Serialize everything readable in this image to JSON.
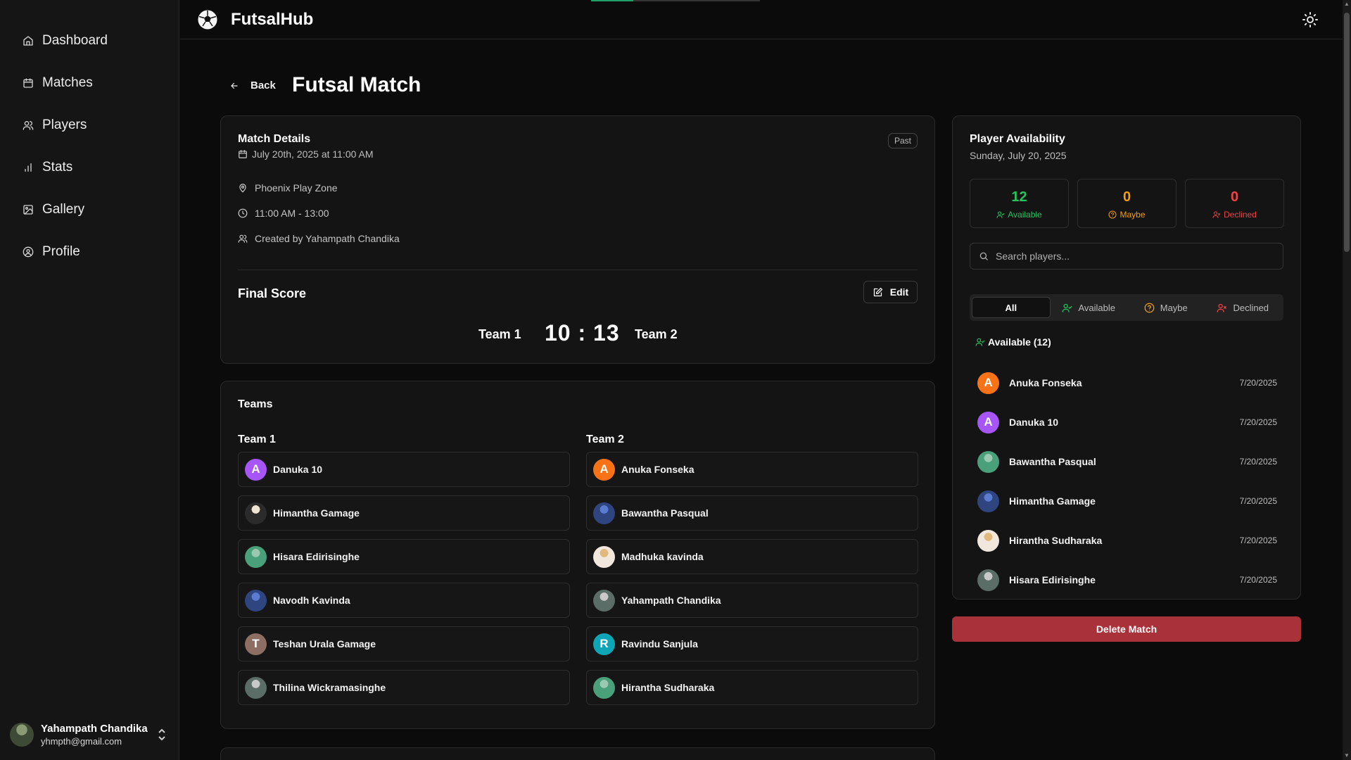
{
  "app": {
    "name": "FutsalHub",
    "loading_progress": 0.25
  },
  "sidebar": {
    "items": [
      {
        "label": "Dashboard",
        "icon": "home-icon"
      },
      {
        "label": "Matches",
        "icon": "calendar-icon"
      },
      {
        "label": "Players",
        "icon": "users-icon"
      },
      {
        "label": "Stats",
        "icon": "bar-chart-icon"
      },
      {
        "label": "Gallery",
        "icon": "image-icon"
      },
      {
        "label": "Profile",
        "icon": "user-circle-icon"
      }
    ],
    "user": {
      "name": "Yahampath Chandika",
      "email": "yhmpth@gmail.com"
    }
  },
  "page": {
    "back_label": "Back",
    "title": "Futsal Match"
  },
  "match_details": {
    "title": "Match Details",
    "date": "July 20th, 2025 at 11:00 AM",
    "status": "Past",
    "location": "Phoenix Play Zone",
    "time": "11:00 AM - 13:00",
    "created_by": "Created by Yahampath Chandika"
  },
  "score": {
    "title": "Final Score",
    "edit_label": "Edit",
    "team1": "Team 1",
    "team2": "Team 2",
    "value": "10 : 13"
  },
  "teams": {
    "title": "Teams",
    "team1": {
      "name": "Team 1",
      "players": [
        {
          "name": "Danuka 10",
          "initial": "A",
          "color": "#a855f7"
        },
        {
          "name": "Himantha Gamage",
          "initial": "",
          "color": ""
        },
        {
          "name": "Hisara Edirisinghe",
          "initial": "",
          "color": ""
        },
        {
          "name": "Navodh Kavinda",
          "initial": "",
          "color": ""
        },
        {
          "name": "Teshan Urala Gamage",
          "initial": "T",
          "color": "#8d6e63"
        },
        {
          "name": "Thilina Wickramasinghe",
          "initial": "",
          "color": ""
        }
      ]
    },
    "team2": {
      "name": "Team 2",
      "players": [
        {
          "name": "Anuka Fonseka",
          "initial": "A",
          "color": "#f97316"
        },
        {
          "name": "Bawantha Pasqual",
          "initial": "",
          "color": ""
        },
        {
          "name": "Madhuka kavinda",
          "initial": "",
          "color": ""
        },
        {
          "name": "Yahampath Chandika",
          "initial": "",
          "color": ""
        },
        {
          "name": "Ravindu Sanjula",
          "initial": "R",
          "color": "#0ea5b7"
        },
        {
          "name": "Hirantha Sudharaka",
          "initial": "",
          "color": ""
        }
      ]
    }
  },
  "availability": {
    "title": "Player Availability",
    "date": "Sunday, July 20, 2025",
    "stats": {
      "available": {
        "count": "12",
        "label": "Available",
        "color": "#22c55e"
      },
      "maybe": {
        "count": "0",
        "label": "Maybe",
        "color": "#f59e0b"
      },
      "declined": {
        "count": "0",
        "label": "Declined",
        "color": "#ef4444"
      }
    },
    "search_placeholder": "Search players...",
    "filters": [
      "All",
      "Available",
      "Maybe",
      "Declined"
    ],
    "active_filter": "All",
    "section_heading": "Available (12)",
    "list": [
      {
        "name": "Anuka Fonseka",
        "date": "7/20/2025",
        "initial": "A",
        "color": "#f97316"
      },
      {
        "name": "Danuka 10",
        "date": "7/20/2025",
        "initial": "A",
        "color": "#a855f7"
      },
      {
        "name": "Bawantha Pasqual",
        "date": "7/20/2025",
        "initial": "",
        "color": ""
      },
      {
        "name": "Himantha Gamage",
        "date": "7/20/2025",
        "initial": "",
        "color": ""
      },
      {
        "name": "Hirantha Sudharaka",
        "date": "7/20/2025",
        "initial": "",
        "color": ""
      },
      {
        "name": "Hisara Edirisinghe",
        "date": "7/20/2025",
        "initial": "",
        "color": ""
      }
    ]
  },
  "actions": {
    "delete_label": "Delete Match",
    "delete_color": "#a9323a"
  }
}
